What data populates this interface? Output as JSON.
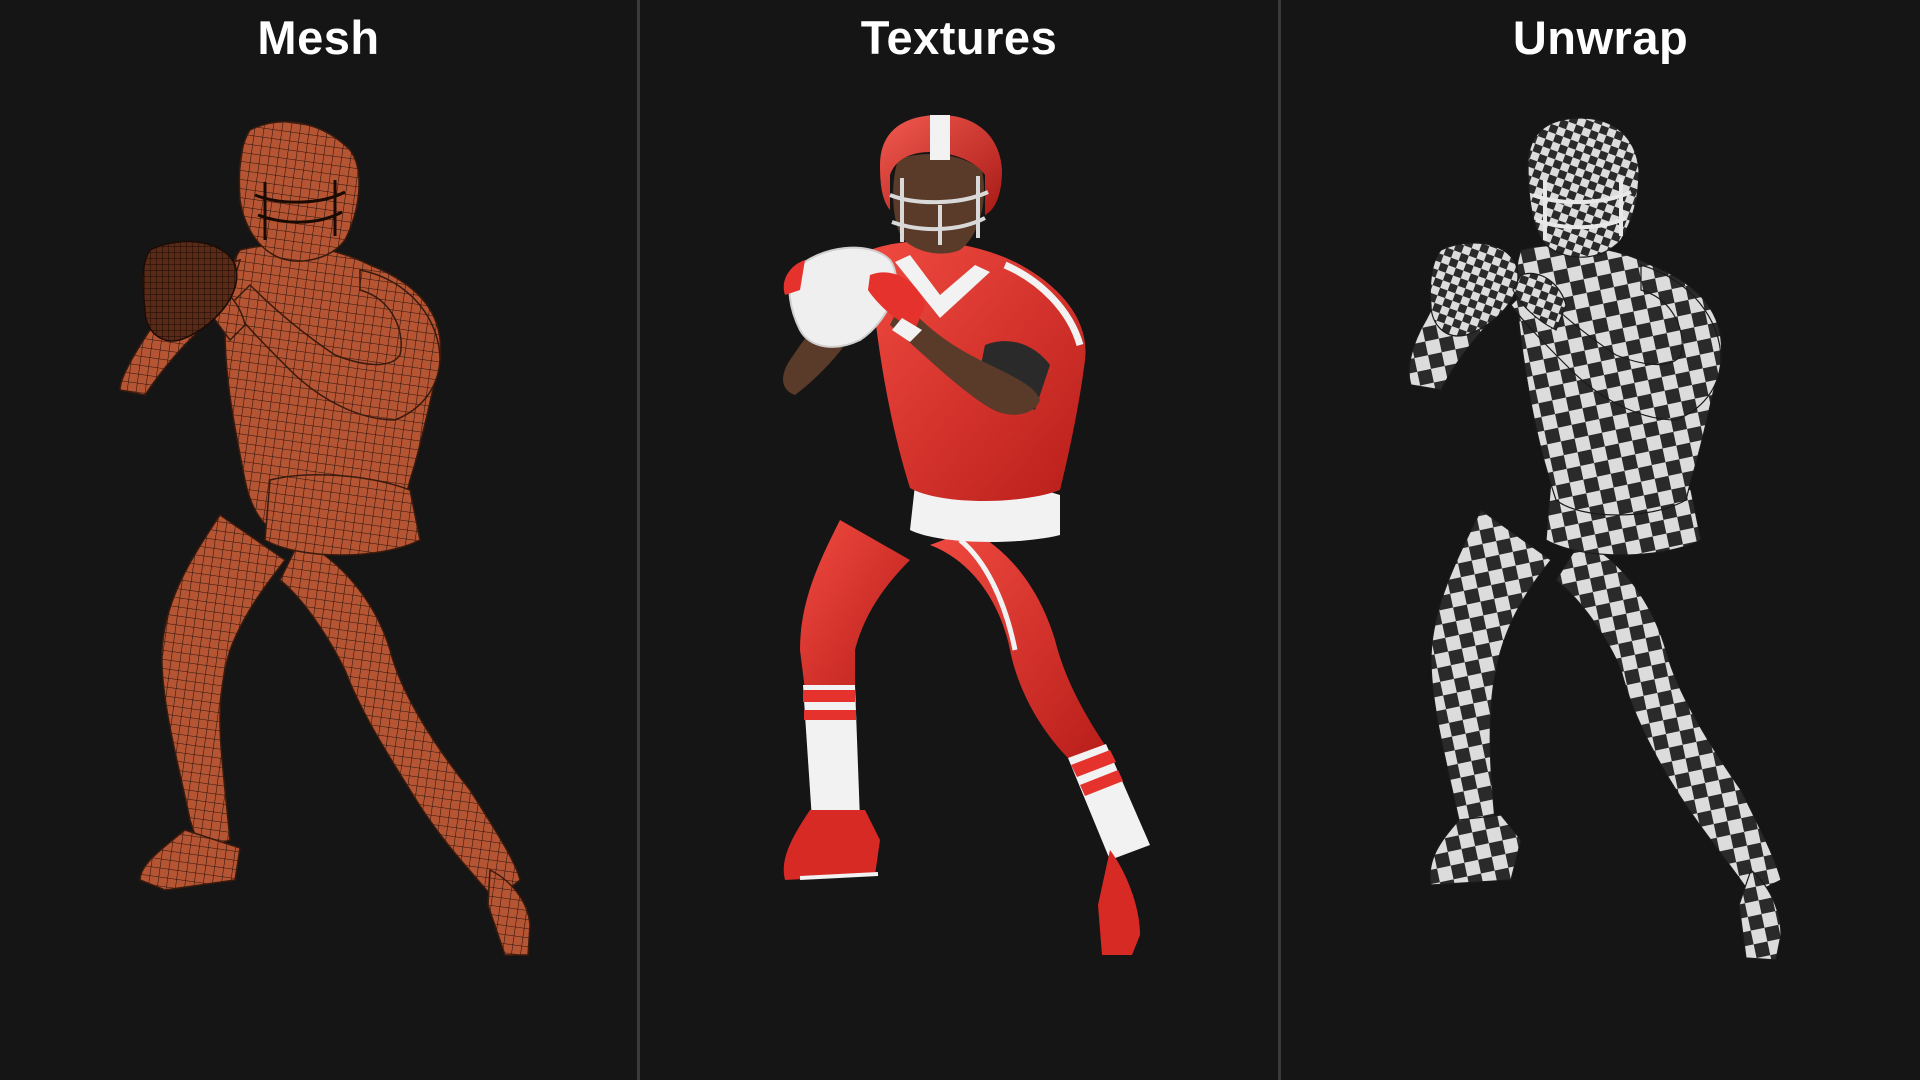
{
  "panels": [
    {
      "title": "Mesh",
      "style": "wireframe",
      "color": "#c05a36"
    },
    {
      "title": "Textures",
      "style": "textured",
      "color": "#e5322d"
    },
    {
      "title": "Unwrap",
      "style": "checker",
      "color": "#d8d8d8"
    }
  ],
  "colors": {
    "background": "#151515",
    "divider": "#3a3a3a",
    "title": "#ffffff",
    "accent_white": "#f2f2f2",
    "armband": "#2a2a2a",
    "skin": "#5a3a28"
  }
}
